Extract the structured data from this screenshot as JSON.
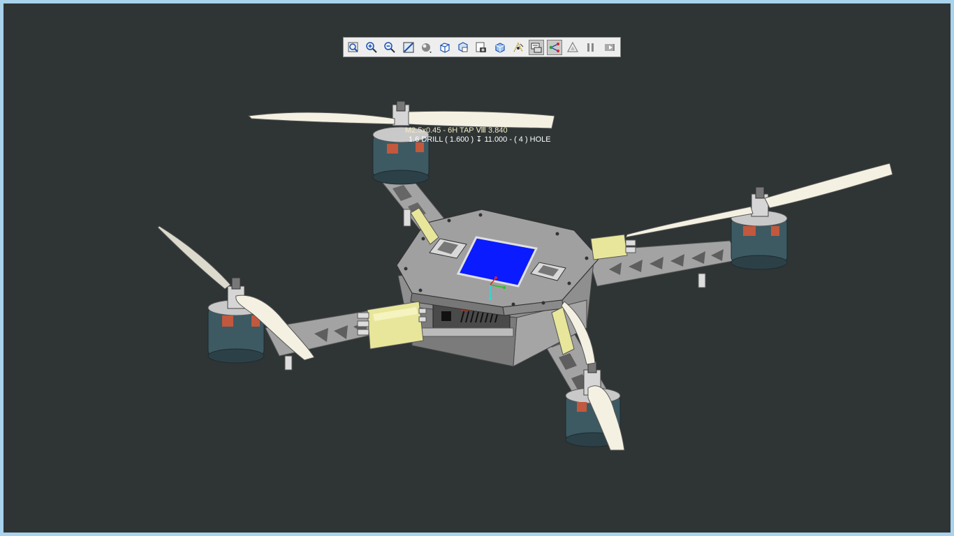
{
  "window": {
    "bg_color": "#a9d2ec",
    "viewport_bg": "#2f3435"
  },
  "toolbar": {
    "items": [
      {
        "icon": "zoom-fit-icon",
        "active": false
      },
      {
        "icon": "zoom-in-icon",
        "active": false
      },
      {
        "icon": "zoom-out-icon",
        "active": false
      },
      {
        "icon": "zoom-area-icon",
        "active": false
      },
      {
        "icon": "shading-icon",
        "active": false
      },
      {
        "icon": "view-cube-icon",
        "active": false
      },
      {
        "icon": "saved-views-icon",
        "active": false
      },
      {
        "icon": "snapshot-icon",
        "active": false
      },
      {
        "icon": "view-orient-icon",
        "active": false
      },
      {
        "icon": "datum-display-icon",
        "active": false
      },
      {
        "icon": "annotation-display-icon",
        "active": true
      },
      {
        "icon": "spin-center-icon",
        "active": true
      },
      {
        "icon": "perspective-icon",
        "active": false
      },
      {
        "icon": "pause-icon",
        "active": false
      },
      {
        "icon": "next-icon",
        "active": false
      }
    ]
  },
  "annotation": {
    "line1": "M2.5x0.45 - 6H TAP Ⅷ 3.840",
    "line2": "1.6 DRILL ( 1.600 ) ↧ 11.000 - ( 4 ) HOLE"
  },
  "model": {
    "colors": {
      "frame": "#9a9a9a",
      "frame_dark": "#6e6e6e",
      "propeller": "#f4f1e2",
      "motor": "#3d5a63",
      "motor_accent": "#c2583d",
      "esc": "#e8e69a",
      "screen": "#0a1bff"
    }
  }
}
